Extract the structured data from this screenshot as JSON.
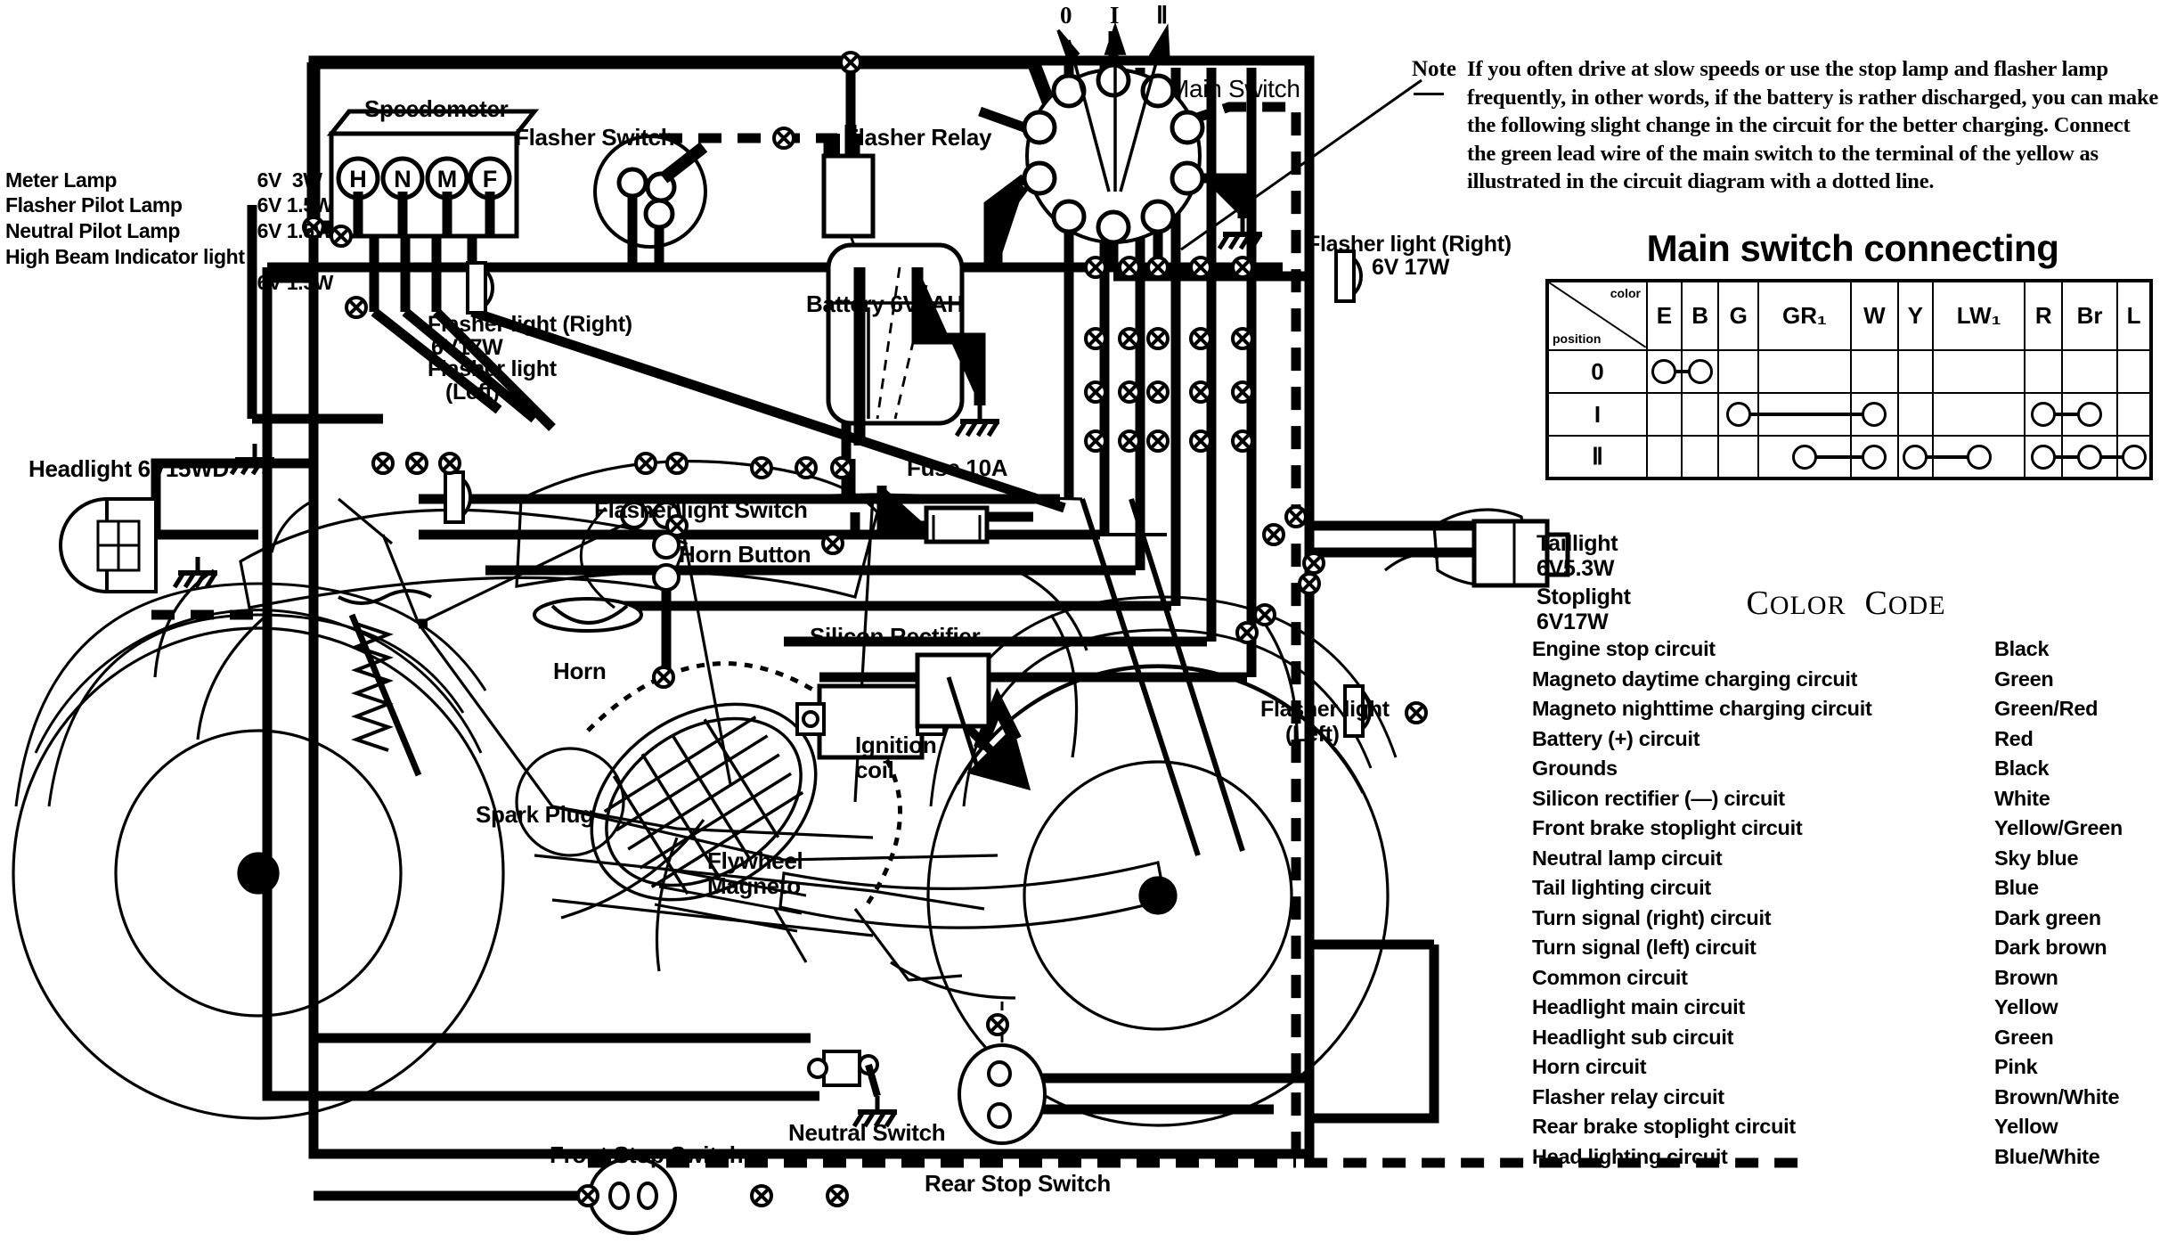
{
  "specs": {
    "rows": [
      {
        "name": "Meter Lamp",
        "value": "6V  3W"
      },
      {
        "name": "Flasher Pilot Lamp",
        "value": "6V 1.5W"
      },
      {
        "name": "Neutral Pilot Lamp",
        "value": "6V 1.5W"
      },
      {
        "name": "High Beam Indicator light",
        "value": ""
      },
      {
        "name": "",
        "value": "6V 1.5W"
      }
    ]
  },
  "note": {
    "label": "Note",
    "body": "If you often drive at slow speeds or use the stop lamp and flasher lamp frequently, in other words, if the battery is rather discharged, you can make the following slight change in the circuit for the better charging.\nConnect the green lead wire of the main switch to the terminal of the yellow as illustrated in the circuit diagram with a dotted line."
  },
  "main_switch_table": {
    "title": "Main switch connecting",
    "corner_color_label": "color",
    "corner_position_label": "position",
    "columns": [
      "E",
      "B",
      "G",
      "GR₁",
      "W",
      "Y",
      "LW₁",
      "R",
      "Br",
      "L"
    ],
    "rows": [
      {
        "position": "0",
        "connections": [
          [
            "E",
            "B"
          ]
        ]
      },
      {
        "position": "I",
        "connections": [
          [
            "G",
            "W"
          ],
          [
            "R",
            "Br"
          ]
        ]
      },
      {
        "position": "Ⅱ",
        "connections": [
          [
            "GR₁",
            "W"
          ],
          [
            "Y",
            "LW₁"
          ],
          [
            "R",
            "Br",
            "L"
          ]
        ]
      }
    ]
  },
  "color_code": {
    "title": "Color Code",
    "rows": [
      {
        "circuit": "Engine stop circuit",
        "color": "Black"
      },
      {
        "circuit": "Magneto daytime charging circuit",
        "color": "Green"
      },
      {
        "circuit": "Magneto nighttime charging circuit",
        "color": "Green/Red"
      },
      {
        "circuit": "Battery (+) circuit",
        "color": "Red"
      },
      {
        "circuit": "Grounds",
        "color": "Black"
      },
      {
        "circuit": "Silicon rectifier (—) circuit",
        "color": "White"
      },
      {
        "circuit": "Front brake stoplight circuit",
        "color": "Yellow/Green"
      },
      {
        "circuit": "Neutral lamp circuit",
        "color": "Sky blue"
      },
      {
        "circuit": "Tail lighting circuit",
        "color": "Blue"
      },
      {
        "circuit": "Turn signal (right) circuit",
        "color": "Dark green"
      },
      {
        "circuit": "Turn signal (left) circuit",
        "color": "Dark brown"
      },
      {
        "circuit": "Common circuit",
        "color": "Brown"
      },
      {
        "circuit": "Headlight main circuit",
        "color": "Yellow"
      },
      {
        "circuit": "Headlight sub circuit",
        "color": "Green"
      },
      {
        "circuit": "Horn circuit",
        "color": "Pink"
      },
      {
        "circuit": "Flasher relay circuit",
        "color": "Brown/White"
      },
      {
        "circuit": "Rear brake stoplight circuit",
        "color": "Yellow"
      },
      {
        "circuit": "Head lighting circuit",
        "color": "Blue/White"
      }
    ]
  },
  "diagram_labels": {
    "speedometer": "Speedometer",
    "speedometer_terminals": [
      "H",
      "N",
      "M",
      "F"
    ],
    "flasher_switch": "Flasher Switch",
    "flasher_relay": "Flasher Relay",
    "main_switch": "Main Switch",
    "switch_positions": [
      "0",
      "I",
      "Ⅱ"
    ],
    "battery": "Battery 6V4AH",
    "fuse": "Fuse 10A",
    "flasher_light_right_inner": "Flasher light (Right)",
    "flasher_light_right_inner_rating": "6V17W",
    "flasher_light_left_inner": "Flasher light",
    "flasher_light_left_inner2": "(Left)",
    "headlight": "Headlight 6V15WD",
    "flasher_light_switch": "Flasher light Switch",
    "horn_button": "Horn Button",
    "horn": "Horn",
    "silicon_rectifier": "Silicon Rectifier",
    "ignition_coil": "Ignition",
    "ignition_coil2": "coil",
    "spark_plug": "Spark Plug",
    "flywheel": "Flywheel",
    "magneto": "Magneto",
    "front_stop_switch": "Front Stop Switch",
    "neutral_switch": "Neutral Switch",
    "rear_stop_switch": "Rear Stop Switch",
    "flasher_light_right_outer": "Flasher light (Right)",
    "flasher_light_right_outer_rating": "6V 17W",
    "flasher_light_left_outer": "Flasher light",
    "flasher_light_left_outer2": "(Left)",
    "taillight": "Taillight",
    "taillight_rating": "6V5.3W",
    "stoplight": "Stoplight",
    "stoplight_rating": "6V17W"
  },
  "colors": {
    "ink": "#000000",
    "paper": "#ffffff"
  }
}
